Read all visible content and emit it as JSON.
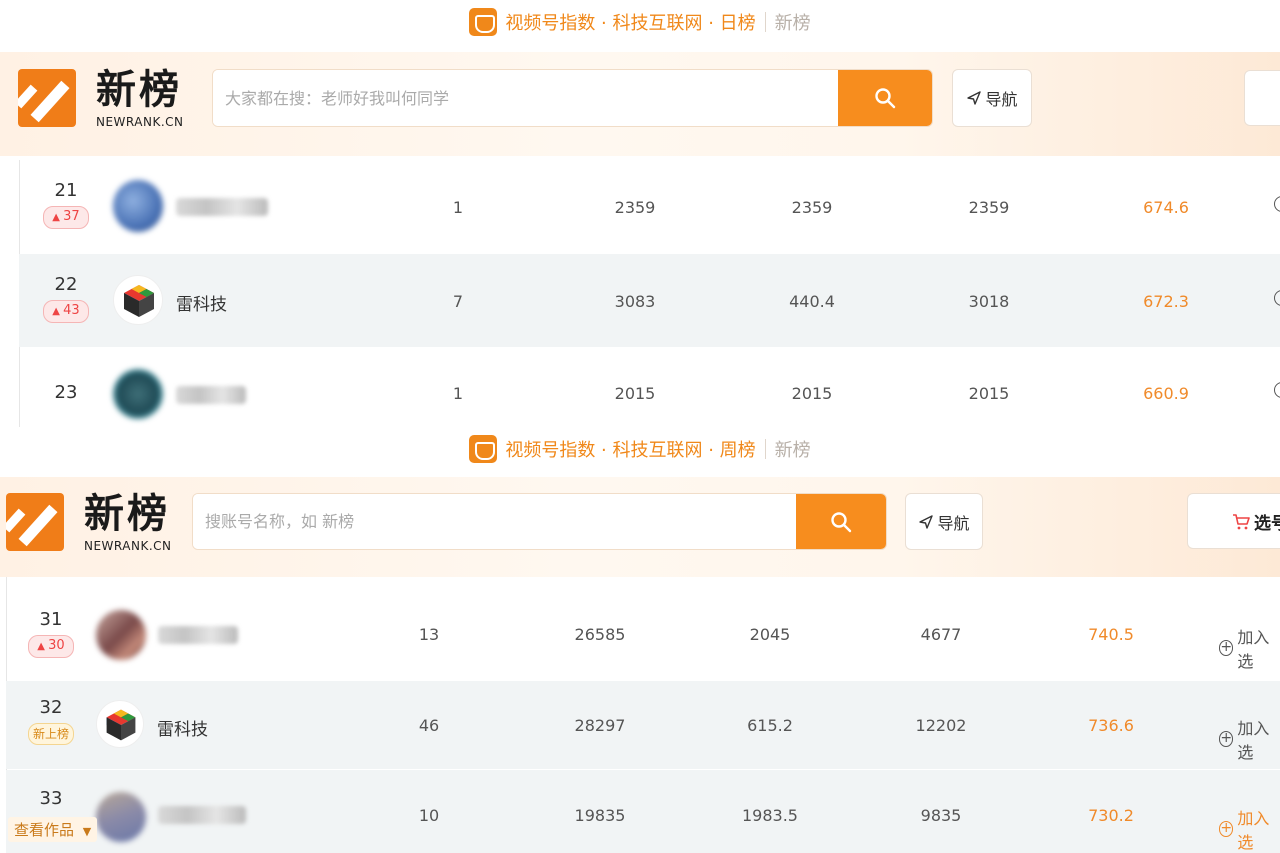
{
  "panels": [
    {
      "title": {
        "text": "视频号指数 · 科技互联网 · 日榜",
        "brand": "新榜"
      },
      "logo": {
        "cn": "新榜",
        "en": "NEWRANK.CN"
      },
      "search": {
        "placeholder": "大家都在搜：老师好我叫何同学"
      },
      "nav_label": "导航",
      "right_label": "",
      "rows": [
        {
          "rank": "21",
          "badge": "37",
          "badge_type": "up",
          "name": "",
          "blurred": true,
          "c1": "1",
          "c2": "2359",
          "c3": "2359",
          "c4": "2359",
          "score": "674.6",
          "add": ""
        },
        {
          "rank": "22",
          "badge": "43",
          "badge_type": "up",
          "name": "雷科技",
          "blurred": false,
          "c1": "7",
          "c2": "3083",
          "c3": "440.4",
          "c4": "3018",
          "score": "672.3",
          "add": ""
        },
        {
          "rank": "23",
          "badge": "",
          "badge_type": "",
          "name": "",
          "blurred": true,
          "c1": "1",
          "c2": "2015",
          "c3": "2015",
          "c4": "2015",
          "score": "660.9",
          "add": ""
        }
      ]
    },
    {
      "title": {
        "text": "视频号指数 · 科技互联网 · 周榜",
        "brand": "新榜"
      },
      "logo": {
        "cn": "新榜",
        "en": "NEWRANK.CN"
      },
      "search": {
        "placeholder": "搜账号名称，如 新榜"
      },
      "nav_label": "导航",
      "right_label": "选号",
      "rows": [
        {
          "rank": "31",
          "badge": "30",
          "badge_type": "up",
          "name": "",
          "blurred": true,
          "c1": "13",
          "c2": "26585",
          "c3": "2045",
          "c4": "4677",
          "score": "740.5",
          "add": "加入选"
        },
        {
          "rank": "32",
          "badge": "新上榜",
          "badge_type": "new",
          "name": "雷科技",
          "blurred": false,
          "c1": "46",
          "c2": "28297",
          "c3": "615.2",
          "c4": "12202",
          "score": "736.6",
          "add": "加入选"
        },
        {
          "rank": "33",
          "badge": "",
          "badge_type": "",
          "name": "",
          "blurred": true,
          "c1": "10",
          "c2": "19835",
          "c3": "1983.5",
          "c4": "9835",
          "score": "730.2",
          "add": "加入选"
        }
      ],
      "view_works": "查看作品"
    }
  ],
  "colors": {
    "accent": "#f78d1e",
    "score": "#f08a2a",
    "badge_up": "#e44444",
    "badge_new": "#d88a1a"
  },
  "icons": [
    "newrank-logo-icon",
    "search-icon",
    "navigation-arrow-icon",
    "cart-icon",
    "add-circle-icon",
    "caret-down-icon",
    "up-triangle-icon"
  ]
}
